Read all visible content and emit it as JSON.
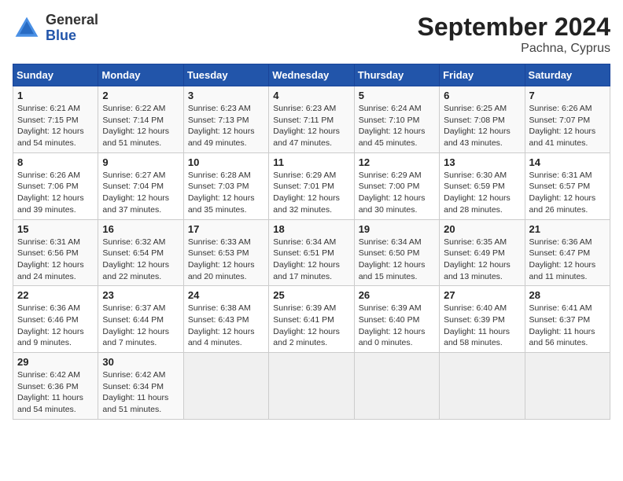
{
  "logo": {
    "general": "General",
    "blue": "Blue"
  },
  "title": "September 2024",
  "location": "Pachna, Cyprus",
  "days_of_week": [
    "Sunday",
    "Monday",
    "Tuesday",
    "Wednesday",
    "Thursday",
    "Friday",
    "Saturday"
  ],
  "weeks": [
    [
      {
        "day": "1",
        "sunrise": "6:21 AM",
        "sunset": "7:15 PM",
        "daylight": "12 hours and 54 minutes."
      },
      {
        "day": "2",
        "sunrise": "6:22 AM",
        "sunset": "7:14 PM",
        "daylight": "12 hours and 51 minutes."
      },
      {
        "day": "3",
        "sunrise": "6:23 AM",
        "sunset": "7:13 PM",
        "daylight": "12 hours and 49 minutes."
      },
      {
        "day": "4",
        "sunrise": "6:23 AM",
        "sunset": "7:11 PM",
        "daylight": "12 hours and 47 minutes."
      },
      {
        "day": "5",
        "sunrise": "6:24 AM",
        "sunset": "7:10 PM",
        "daylight": "12 hours and 45 minutes."
      },
      {
        "day": "6",
        "sunrise": "6:25 AM",
        "sunset": "7:08 PM",
        "daylight": "12 hours and 43 minutes."
      },
      {
        "day": "7",
        "sunrise": "6:26 AM",
        "sunset": "7:07 PM",
        "daylight": "12 hours and 41 minutes."
      }
    ],
    [
      {
        "day": "8",
        "sunrise": "6:26 AM",
        "sunset": "7:06 PM",
        "daylight": "12 hours and 39 minutes."
      },
      {
        "day": "9",
        "sunrise": "6:27 AM",
        "sunset": "7:04 PM",
        "daylight": "12 hours and 37 minutes."
      },
      {
        "day": "10",
        "sunrise": "6:28 AM",
        "sunset": "7:03 PM",
        "daylight": "12 hours and 35 minutes."
      },
      {
        "day": "11",
        "sunrise": "6:29 AM",
        "sunset": "7:01 PM",
        "daylight": "12 hours and 32 minutes."
      },
      {
        "day": "12",
        "sunrise": "6:29 AM",
        "sunset": "7:00 PM",
        "daylight": "12 hours and 30 minutes."
      },
      {
        "day": "13",
        "sunrise": "6:30 AM",
        "sunset": "6:59 PM",
        "daylight": "12 hours and 28 minutes."
      },
      {
        "day": "14",
        "sunrise": "6:31 AM",
        "sunset": "6:57 PM",
        "daylight": "12 hours and 26 minutes."
      }
    ],
    [
      {
        "day": "15",
        "sunrise": "6:31 AM",
        "sunset": "6:56 PM",
        "daylight": "12 hours and 24 minutes."
      },
      {
        "day": "16",
        "sunrise": "6:32 AM",
        "sunset": "6:54 PM",
        "daylight": "12 hours and 22 minutes."
      },
      {
        "day": "17",
        "sunrise": "6:33 AM",
        "sunset": "6:53 PM",
        "daylight": "12 hours and 20 minutes."
      },
      {
        "day": "18",
        "sunrise": "6:34 AM",
        "sunset": "6:51 PM",
        "daylight": "12 hours and 17 minutes."
      },
      {
        "day": "19",
        "sunrise": "6:34 AM",
        "sunset": "6:50 PM",
        "daylight": "12 hours and 15 minutes."
      },
      {
        "day": "20",
        "sunrise": "6:35 AM",
        "sunset": "6:49 PM",
        "daylight": "12 hours and 13 minutes."
      },
      {
        "day": "21",
        "sunrise": "6:36 AM",
        "sunset": "6:47 PM",
        "daylight": "12 hours and 11 minutes."
      }
    ],
    [
      {
        "day": "22",
        "sunrise": "6:36 AM",
        "sunset": "6:46 PM",
        "daylight": "12 hours and 9 minutes."
      },
      {
        "day": "23",
        "sunrise": "6:37 AM",
        "sunset": "6:44 PM",
        "daylight": "12 hours and 7 minutes."
      },
      {
        "day": "24",
        "sunrise": "6:38 AM",
        "sunset": "6:43 PM",
        "daylight": "12 hours and 4 minutes."
      },
      {
        "day": "25",
        "sunrise": "6:39 AM",
        "sunset": "6:41 PM",
        "daylight": "12 hours and 2 minutes."
      },
      {
        "day": "26",
        "sunrise": "6:39 AM",
        "sunset": "6:40 PM",
        "daylight": "12 hours and 0 minutes."
      },
      {
        "day": "27",
        "sunrise": "6:40 AM",
        "sunset": "6:39 PM",
        "daylight": "11 hours and 58 minutes."
      },
      {
        "day": "28",
        "sunrise": "6:41 AM",
        "sunset": "6:37 PM",
        "daylight": "11 hours and 56 minutes."
      }
    ],
    [
      {
        "day": "29",
        "sunrise": "6:42 AM",
        "sunset": "6:36 PM",
        "daylight": "11 hours and 54 minutes."
      },
      {
        "day": "30",
        "sunrise": "6:42 AM",
        "sunset": "6:34 PM",
        "daylight": "11 hours and 51 minutes."
      },
      null,
      null,
      null,
      null,
      null
    ]
  ],
  "labels": {
    "sunrise": "Sunrise:",
    "sunset": "Sunset:",
    "daylight": "Daylight:"
  }
}
